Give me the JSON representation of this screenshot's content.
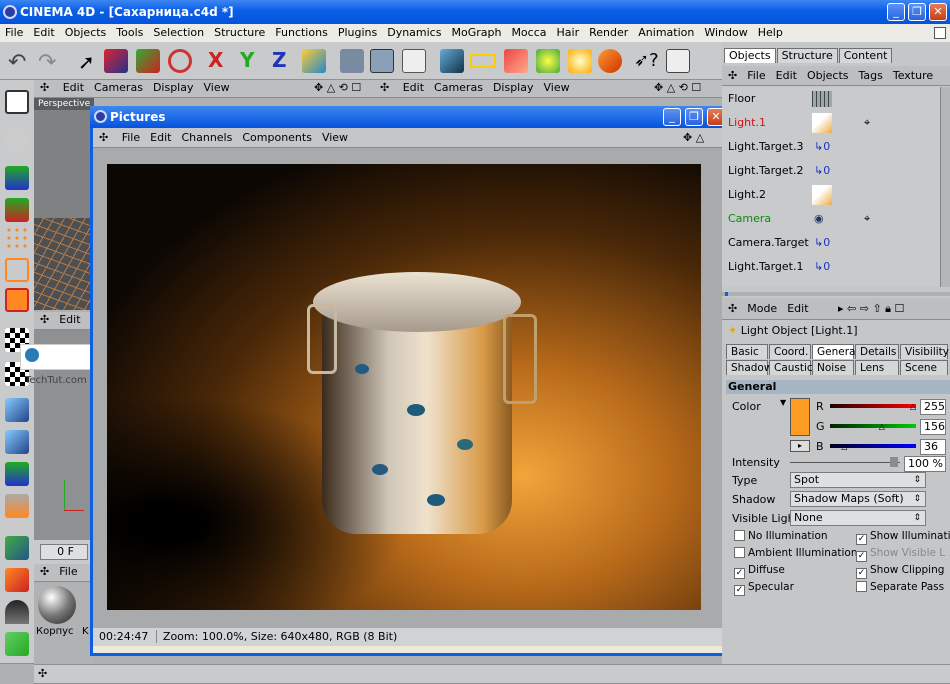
{
  "app": {
    "title": "CINEMA 4D - [Сахарница.c4d *]"
  },
  "menu": [
    "File",
    "Edit",
    "Objects",
    "Tools",
    "Selection",
    "Structure",
    "Functions",
    "Plugins",
    "Dynamics",
    "MoGraph",
    "Mocca",
    "Hair",
    "Render",
    "Animation",
    "Window",
    "Help"
  ],
  "viewport_left": {
    "menu": [
      "Edit",
      "Cameras",
      "Display",
      "View"
    ],
    "label": "Perspective",
    "edit_label": "Edit",
    "frame": "0 F",
    "mat_menu": "File",
    "material": "Корпус",
    "mat2": "K"
  },
  "viewport_right": {
    "menu": [
      "Edit",
      "Cameras",
      "Display",
      "View"
    ]
  },
  "watermark": "TechTut.com",
  "pictures": {
    "title": "Pictures",
    "menu": [
      "File",
      "Edit",
      "Channels",
      "Components",
      "View"
    ],
    "status_time": "00:24:47",
    "status_info": "Zoom: 100.0%, Size: 640x480, RGB (8 Bit)"
  },
  "objects_panel": {
    "tabs": [
      "Objects",
      "Structure",
      "Content"
    ],
    "menu": [
      "File",
      "Edit",
      "Objects",
      "Tags",
      "Texture"
    ],
    "items": [
      {
        "name": "Floor",
        "color": "#000000"
      },
      {
        "name": "Light.1",
        "color": "#d01010"
      },
      {
        "name": "Light.Target.3",
        "color": "#000000"
      },
      {
        "name": "Light.Target.2",
        "color": "#000000"
      },
      {
        "name": "Light.2",
        "color": "#000000"
      },
      {
        "name": "Camera",
        "color": "#0d8a0d"
      },
      {
        "name": "Camera.Target",
        "color": "#000000"
      },
      {
        "name": "Light.Target.1",
        "color": "#000000"
      }
    ]
  },
  "attributes": {
    "menu": [
      "Mode",
      "Edit"
    ],
    "object_label": "Light Object [Light.1]",
    "tabs_row1": [
      "Basic",
      "Coord.",
      "General",
      "Details",
      "Visibility"
    ],
    "tabs_row2": [
      "Shadow",
      "Caustics",
      "Noise",
      "Lens",
      "Scene"
    ],
    "section": "General",
    "color_label": "Color",
    "r_label": "R",
    "g_label": "G",
    "b_label": "B",
    "r": "255",
    "g": "156",
    "b": "36",
    "r_frac": 1.0,
    "g_frac": 0.61,
    "b_frac": 0.14,
    "swatch": "#ff9c24",
    "intensity_label": "Intensity",
    "intensity": "100 %",
    "type_label": "Type",
    "type": "Spot",
    "shadow_label": "Shadow",
    "shadow": "Shadow Maps (Soft)",
    "visible_label": "Visible Light",
    "visible": "None",
    "options": [
      {
        "label": "No Illumination",
        "checked": false
      },
      {
        "label": "Show Illuminati",
        "checked": true
      },
      {
        "label": "Ambient Illumination",
        "checked": false
      },
      {
        "label": "Show Visible L",
        "checked": true
      },
      {
        "label": "Diffuse",
        "checked": true
      },
      {
        "label": "Show Clipping",
        "checked": true
      },
      {
        "label": "Specular",
        "checked": true
      },
      {
        "label": "Separate Pass",
        "checked": false
      }
    ]
  }
}
